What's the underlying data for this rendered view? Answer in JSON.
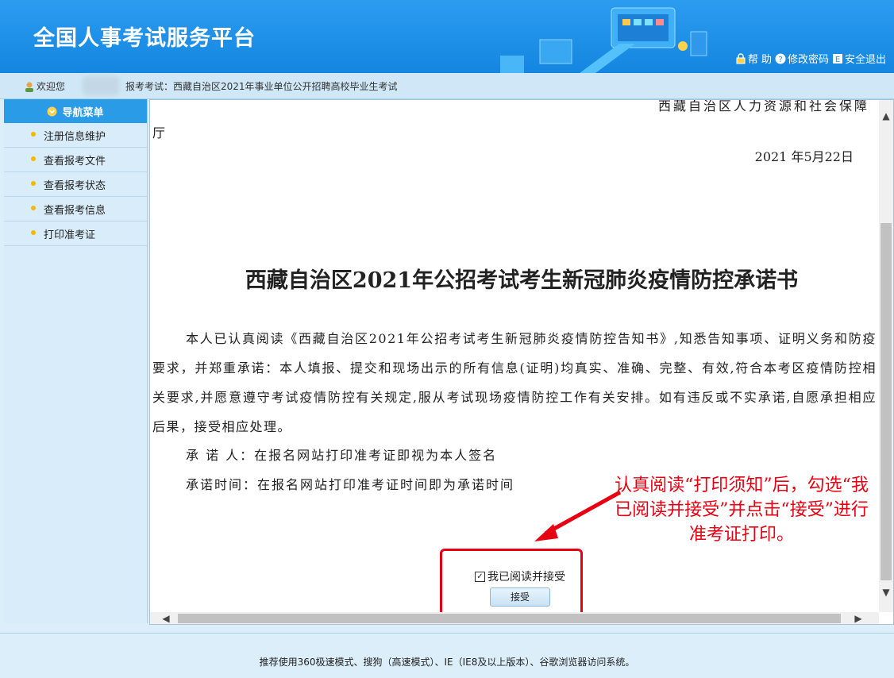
{
  "header": {
    "title": "全国人事考试服务平台",
    "links": [
      {
        "label": "帮 助",
        "icon": "lock-icon"
      },
      {
        "label": "修改密码",
        "icon": "question-icon"
      },
      {
        "label": "安全退出",
        "icon": "exit-icon"
      }
    ]
  },
  "welcome": {
    "greeting": "欢迎您",
    "exam_label": "报考考试：西藏自治区2021年事业单位公开招聘高校毕业生考试"
  },
  "sidebar": {
    "header": "导航菜单",
    "items": [
      {
        "label": "注册信息维护"
      },
      {
        "label": "查看报考文件"
      },
      {
        "label": "查看报考状态"
      },
      {
        "label": "查看报考信息"
      },
      {
        "label": "打印准考证"
      }
    ]
  },
  "document": {
    "issuer": "西藏自治区人力资源和社会保障",
    "issuer_cont": "厅",
    "date": "2021 年5月22日",
    "title": "西藏自治区2021年公招考试考生新冠肺炎疫情防控承诺书",
    "paragraph": "本人已认真阅读《西藏自治区2021年公招考试考生新冠肺炎疫情防控告知书》,知悉告知事项、证明义务和防疫要求，并郑重承诺：本人填报、提交和现场出示的所有信息(证明)均真实、准确、完整、有效,符合本考区疫情防控相关要求,并愿意遵守考试疫情防控有关规定,服从考试现场疫情防控工作有关安排。如有违反或不实承诺,自愿承担相应后果，接受相应处理。",
    "signer": "承 诺 人：在报名网站打印准考证即视为本人签名",
    "sign_time": "承诺时间：在报名网站打印准考证时间即为承诺时间"
  },
  "accept": {
    "checkbox_label": "我已阅读并接受",
    "checked": true,
    "button_label": "接受"
  },
  "annotation": "认真阅读“打印须知”后，勾选“我已阅读并接受”并点击“接受”进行准考证打印。",
  "footer": {
    "text": "推荐使用360极速模式、搜狗（高速模式）、IE（IE8及以上版本）、谷歌浏览器访问系统。"
  },
  "colors": {
    "header_blue": "#1f93e8",
    "accent_red": "#e60012"
  }
}
